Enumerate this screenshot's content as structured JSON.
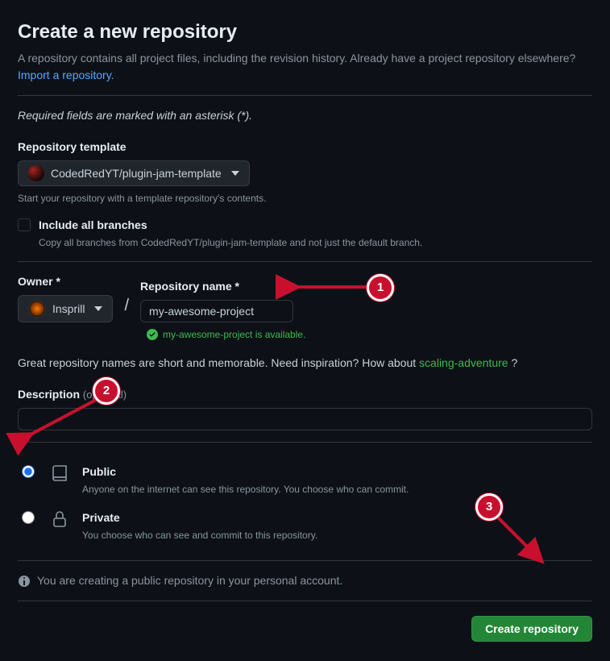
{
  "header": {
    "title": "Create a new repository",
    "subtitle_prefix": "A repository contains all project files, including the revision history. Already have a project repository elsewhere? ",
    "import_link": "Import a repository.",
    "required_note": "Required fields are marked with an asterisk (*)."
  },
  "template": {
    "label": "Repository template",
    "selected": "CodedRedYT/plugin-jam-template",
    "hint": "Start your repository with a template repository's contents."
  },
  "include_branches": {
    "label": "Include all branches",
    "desc": "Copy all branches from CodedRedYT/plugin-jam-template and not just the default branch.",
    "checked": false
  },
  "owner": {
    "label": "Owner *",
    "name": "Insprill"
  },
  "repo": {
    "label": "Repository name *",
    "value": "my-awesome-project",
    "available_msg": "my-awesome-project is available."
  },
  "inspiration": {
    "prefix": "Great repository names are short and memorable. Need inspiration? How about ",
    "suggestion": "scaling-adventure",
    "suffix": " ?"
  },
  "description": {
    "label": "Description",
    "optional": "(optional)",
    "value": ""
  },
  "visibility": {
    "public": {
      "title": "Public",
      "desc": "Anyone on the internet can see this repository. You choose who can commit."
    },
    "private": {
      "title": "Private",
      "desc": "You choose who can see and commit to this repository."
    },
    "selected": "public"
  },
  "info_note": "You are creating a public repository in your personal account.",
  "create_button": "Create repository",
  "annotations": {
    "b1": "1",
    "b2": "2",
    "b3": "3"
  }
}
